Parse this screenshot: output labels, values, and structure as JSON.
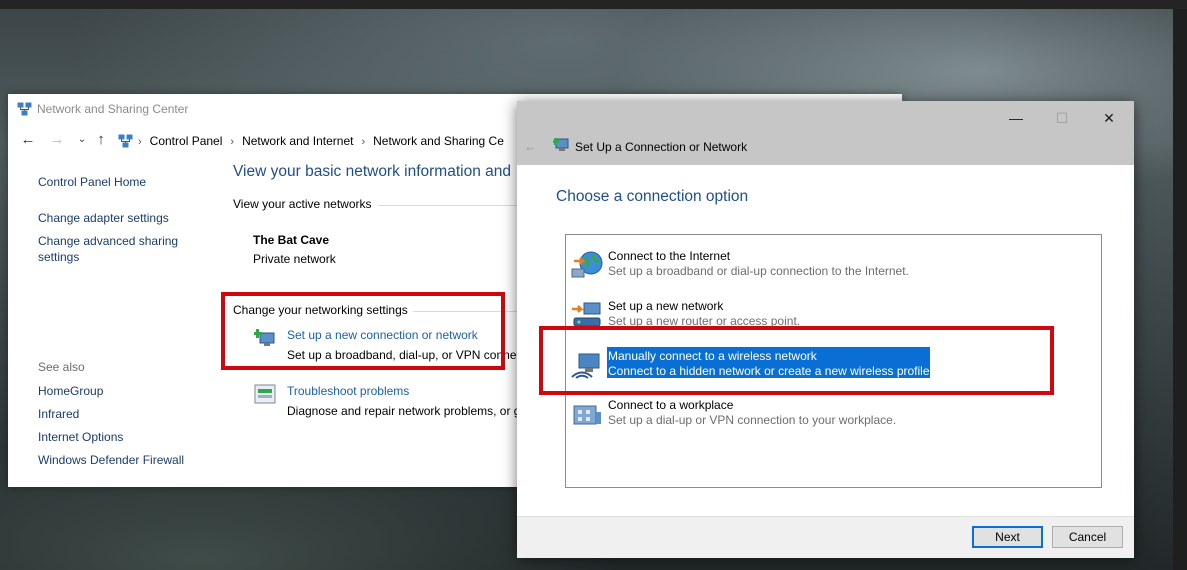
{
  "nsc": {
    "title": "Network and Sharing Center",
    "breadcrumbs": [
      "Control Panel",
      "Network and Internet",
      "Network and Sharing Ce"
    ],
    "left_nav": {
      "home": "Control Panel Home",
      "adapter": "Change adapter settings",
      "advanced_1": "Change advanced sharing",
      "advanced_2": "settings",
      "see_also": "See also",
      "homegroup": "HomeGroup",
      "infrared": "Infrared",
      "internet_options": "Internet Options",
      "firewall": "Windows Defender Firewall"
    },
    "heading": "View your basic network information and",
    "active_networks_label": "View your active networks",
    "network_name": "The Bat Cave",
    "network_type": "Private network",
    "change_settings_label": "Change your networking settings",
    "tasks": [
      {
        "link": "Set up a new connection or network",
        "desc": "Set up a broadband, dial-up, or VPN conne",
        "icon": "new-connection-icon"
      },
      {
        "link": "Troubleshoot problems",
        "desc": "Diagnose and repair network problems, or g",
        "icon": "troubleshoot-icon"
      }
    ]
  },
  "dialog": {
    "title": "Set Up a Connection or Network",
    "heading": "Choose a connection option",
    "options": [
      {
        "title": "Connect to the Internet",
        "desc": "Set up a broadband or dial-up connection to the Internet.",
        "icon": "globe-icon"
      },
      {
        "title": "Set up a new network",
        "desc": "Set up a new router or access point.",
        "icon": "router-icon"
      },
      {
        "title": "Manually connect to a wireless network",
        "desc": "Connect to a hidden network or create a new wireless profile.",
        "icon": "wireless-icon",
        "selected": true
      },
      {
        "title": "Connect to a workplace",
        "desc": "Set up a dial-up or VPN connection to your workplace.",
        "icon": "workplace-icon"
      }
    ],
    "buttons": {
      "next": "Next",
      "cancel": "Cancel"
    },
    "window_controls": {
      "minimize": "—",
      "maximize": "☐",
      "close": "✕",
      "back": "←"
    }
  },
  "colors": {
    "highlight_box": "#d0080e",
    "selection": "#0a6fd4",
    "link": "#1a5fb4"
  }
}
